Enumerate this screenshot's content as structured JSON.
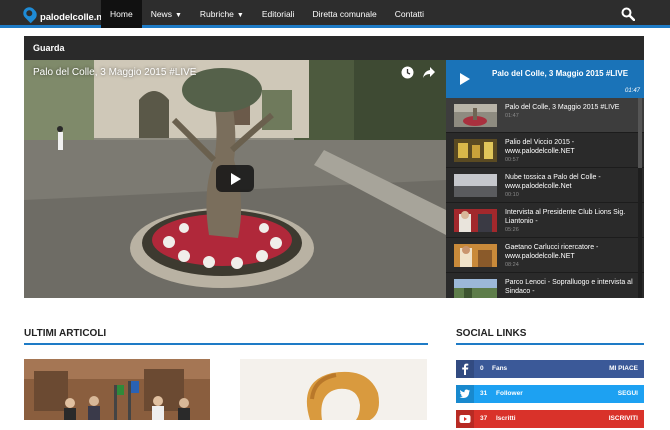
{
  "site": {
    "logo_text": "palodelcolle.net"
  },
  "nav": {
    "items": [
      {
        "label": "Home",
        "active": true,
        "dropdown": false
      },
      {
        "label": "News",
        "active": false,
        "dropdown": true
      },
      {
        "label": "Rubriche",
        "active": false,
        "dropdown": true
      },
      {
        "label": "Editoriali",
        "active": false,
        "dropdown": false
      },
      {
        "label": "Diretta comunale",
        "active": false,
        "dropdown": false
      },
      {
        "label": "Contatti",
        "active": false,
        "dropdown": false
      }
    ],
    "search_icon": "search-icon"
  },
  "video_widget": {
    "title": "Guarda",
    "player": {
      "title": "Palo del Colle, 3 Maggio 2015 #LIVE",
      "icons": [
        "clock-icon",
        "share-icon"
      ]
    },
    "playlist_header": {
      "title": "Palo del Colle, 3 Maggio 2015 #LIVE",
      "duration": "01:47"
    },
    "playlist": [
      {
        "title": "Palo del Colle, 3 Maggio 2015 #LIVE",
        "duration": "01:47",
        "active": true
      },
      {
        "title": "Palio del Viccio 2015 - www.palodelcolle.NET",
        "duration": "00:57",
        "active": false
      },
      {
        "title": "Nube tossica a Palo del Colle - www.palodelcolle.Net",
        "duration": "00:10",
        "active": false
      },
      {
        "title": "Intervista al Presidente Club Lions Sig. Liantonio -",
        "duration": "05:26",
        "active": false
      },
      {
        "title": "Gaetano Carlucci ricercatore - www.palodelcolle.NET",
        "duration": "08:24",
        "active": false
      },
      {
        "title": "Parco Lenoci - Sopralluogo e intervista al Sindaco -",
        "duration": "",
        "active": false
      }
    ]
  },
  "latest": {
    "title": "ULTIMI ARTICOLI"
  },
  "social": {
    "title": "SOCIAL LINKS",
    "rows": [
      {
        "network": "facebook",
        "icon": "facebook-icon",
        "count": "0",
        "label": "Fans",
        "action": "MI PIACE",
        "color": "#3b5998"
      },
      {
        "network": "twitter",
        "icon": "twitter-icon",
        "count": "31",
        "label": "Follower",
        "action": "SEGUI",
        "color": "#1da1f2"
      },
      {
        "network": "youtube",
        "icon": "youtube-icon",
        "count": "37",
        "label": "Iscritti",
        "action": "ISCRIVITI",
        "color": "#d9322a"
      }
    ]
  },
  "colors": {
    "accent": "#1e7bc6",
    "nav_bg": "#2d2d2d",
    "playlist_header": "#1a73b8"
  }
}
